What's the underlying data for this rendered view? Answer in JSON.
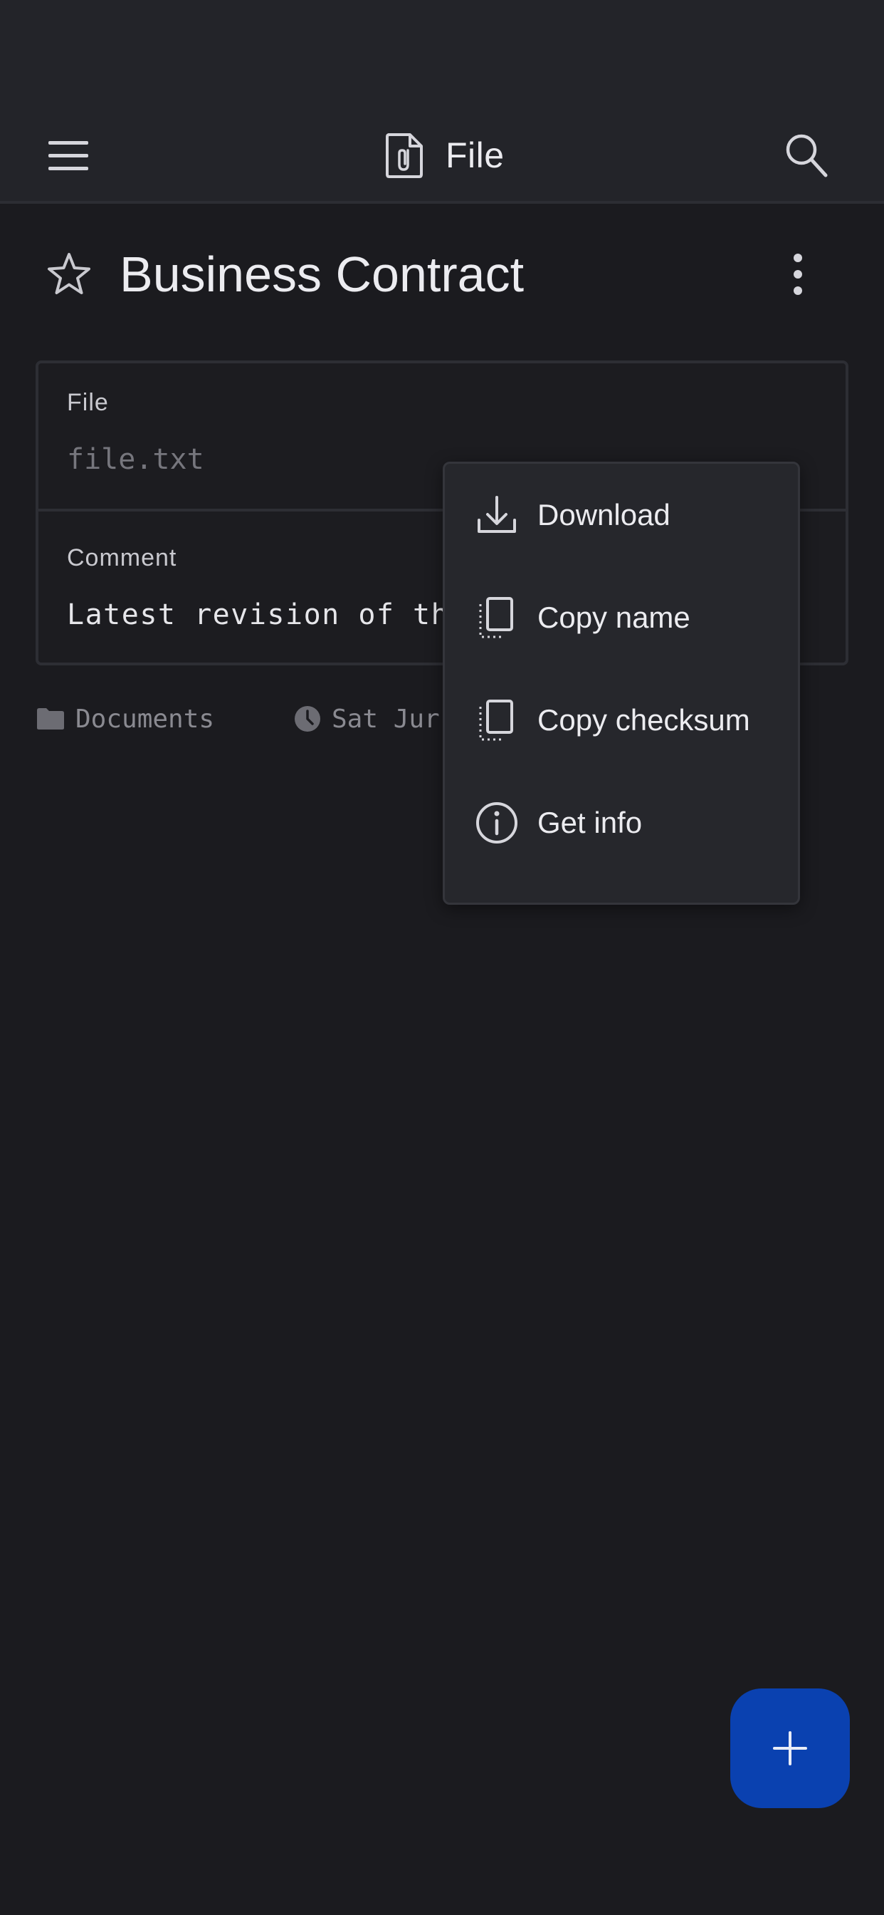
{
  "app_bar": {
    "title": "File"
  },
  "document": {
    "title": "Business Contract",
    "starred": false
  },
  "card": {
    "file_label": "File",
    "file_value": "file.txt",
    "comment_label": "Comment",
    "comment_value": "Latest revision of th"
  },
  "meta": {
    "folder": "Documents",
    "date": "Sat Jur"
  },
  "menu": {
    "items": [
      {
        "label": "Download",
        "icon": "download-icon"
      },
      {
        "label": "Copy name",
        "icon": "copy-icon"
      },
      {
        "label": "Copy checksum",
        "icon": "copy-icon"
      },
      {
        "label": "Get info",
        "icon": "info-icon"
      }
    ]
  },
  "colors": {
    "background": "#1b1b1f",
    "app_bar": "#232429",
    "menu_bg": "#26272c",
    "fab": "#0a41b0"
  }
}
